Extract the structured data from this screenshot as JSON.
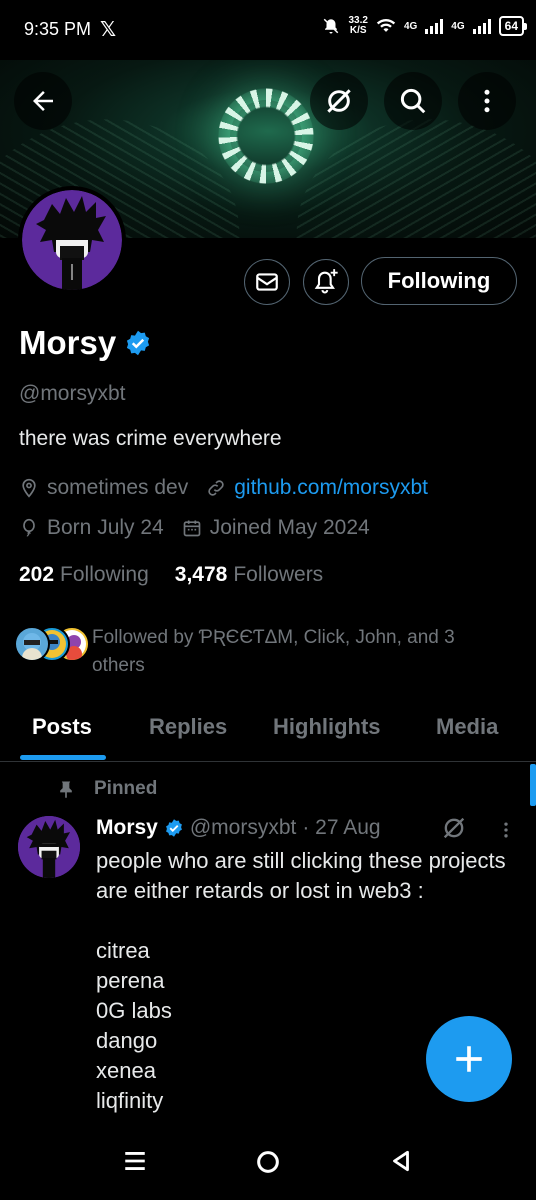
{
  "status_bar": {
    "time": "9:35 PM",
    "app_icon": "x-logo-icon",
    "speed_value": "33.2",
    "speed_unit": "K/S",
    "net1": "4G",
    "net2": "4G",
    "battery": "64"
  },
  "header": {
    "back_icon": "arrow-left-icon",
    "grok_icon": "grok-icon",
    "search_icon": "search-icon",
    "more_icon": "more-vertical-icon"
  },
  "profile": {
    "name": "Morsy",
    "verified": true,
    "handle": "@morsyxbt",
    "bio": "there was crime everywhere",
    "location": "sometimes dev",
    "website": "github.com/morsyxbt",
    "birthday": "Born July 24",
    "joined": "Joined May 2024",
    "following_count": "202",
    "following_label": "Following",
    "followers_count": "3,478",
    "followers_label": "Followers",
    "followed_by": "Followed by ƤƦЄЄƬΔM, Click, John, and 3 others",
    "following_button": "Following"
  },
  "tabs": [
    "Posts",
    "Replies",
    "Highlights",
    "Media"
  ],
  "active_tab": "Posts",
  "pinned_post": {
    "pinned_label": "Pinned",
    "author": "Morsy",
    "handle": "@morsyxbt",
    "date": "· 27 Aug",
    "text": "people who are still clicking these projects are either retards or lost in web3 :\n\ncitrea\nperena\n0G labs\ndango\nxenea\nliqfinity"
  },
  "colors": {
    "accent": "#1d9bf0",
    "muted": "#71767b",
    "background": "#000000",
    "avatar_bg": "#5c2a9c"
  },
  "navbar": {
    "recents_icon": "menu-icon",
    "home_icon": "circle-home-icon",
    "back_icon": "triangle-back-icon"
  }
}
